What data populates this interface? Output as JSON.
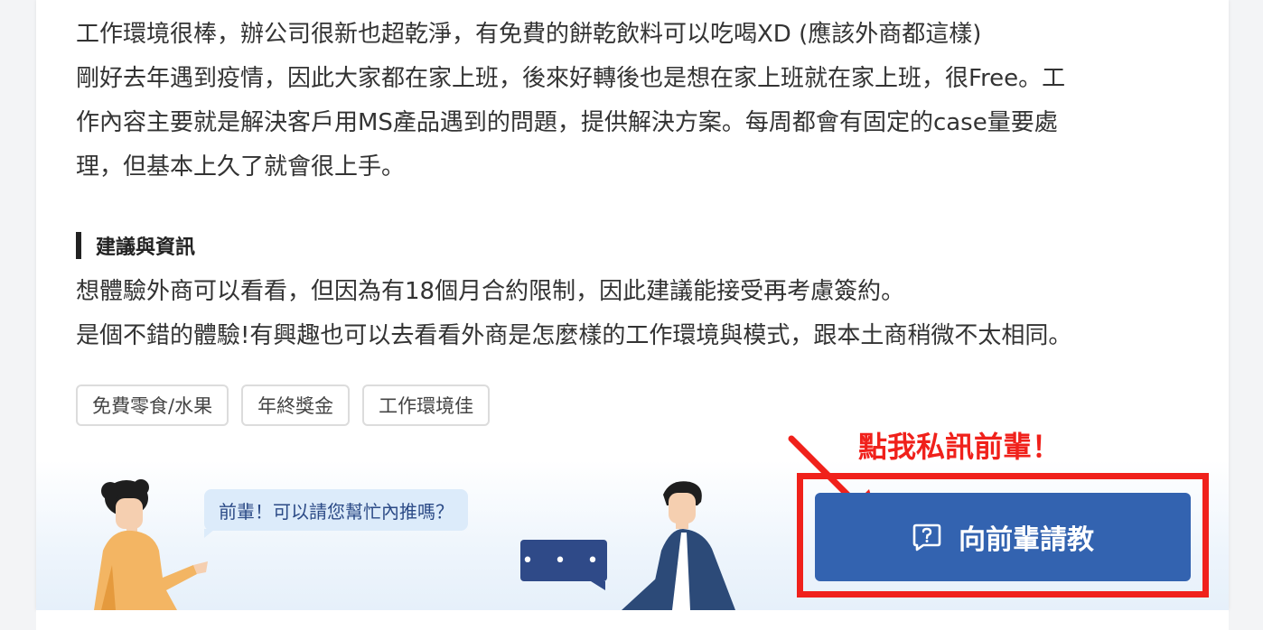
{
  "content": {
    "paragraph1_lines": [
      "工作環境很棒，辦公司很新也超乾淨，有免費的餅乾飲料可以吃喝XD (應該外商都這樣)",
      "剛好去年遇到疫情，因此大家都在家上班，後來好轉後也是想在家上班就在家上班，很Free。工",
      "作內容主要就是解決客戶用MS產品遇到的問題，提供解決方案。每周都會有固定的case量要處",
      "理，但基本上久了就會很上手。"
    ],
    "section_title": "建議與資訊",
    "paragraph2_lines": [
      "想體驗外商可以看看，但因為有18個月合約限制，因此建議能接受再考慮簽約。",
      "是個不錯的體驗!有興趣也可以去看看外商是怎麼樣的工作環境與模式，跟本土商稍微不太相同。"
    ],
    "tags": [
      "免費零食/水果",
      "年終獎金",
      "工作環境佳"
    ]
  },
  "banner": {
    "speech_bubble": "前輩！可以請您幫忙內推嗎？",
    "reply_dots": "• • •"
  },
  "cta": {
    "annotation": "點我私訊前輩！",
    "button_label": "向前輩請教",
    "button_icon": "question-message-icon"
  },
  "colors": {
    "primary_button": "#3363b0",
    "annotation_red": "#f0211b",
    "bubble_bg": "#dcebfa",
    "dots_bg": "#2f4a88"
  }
}
